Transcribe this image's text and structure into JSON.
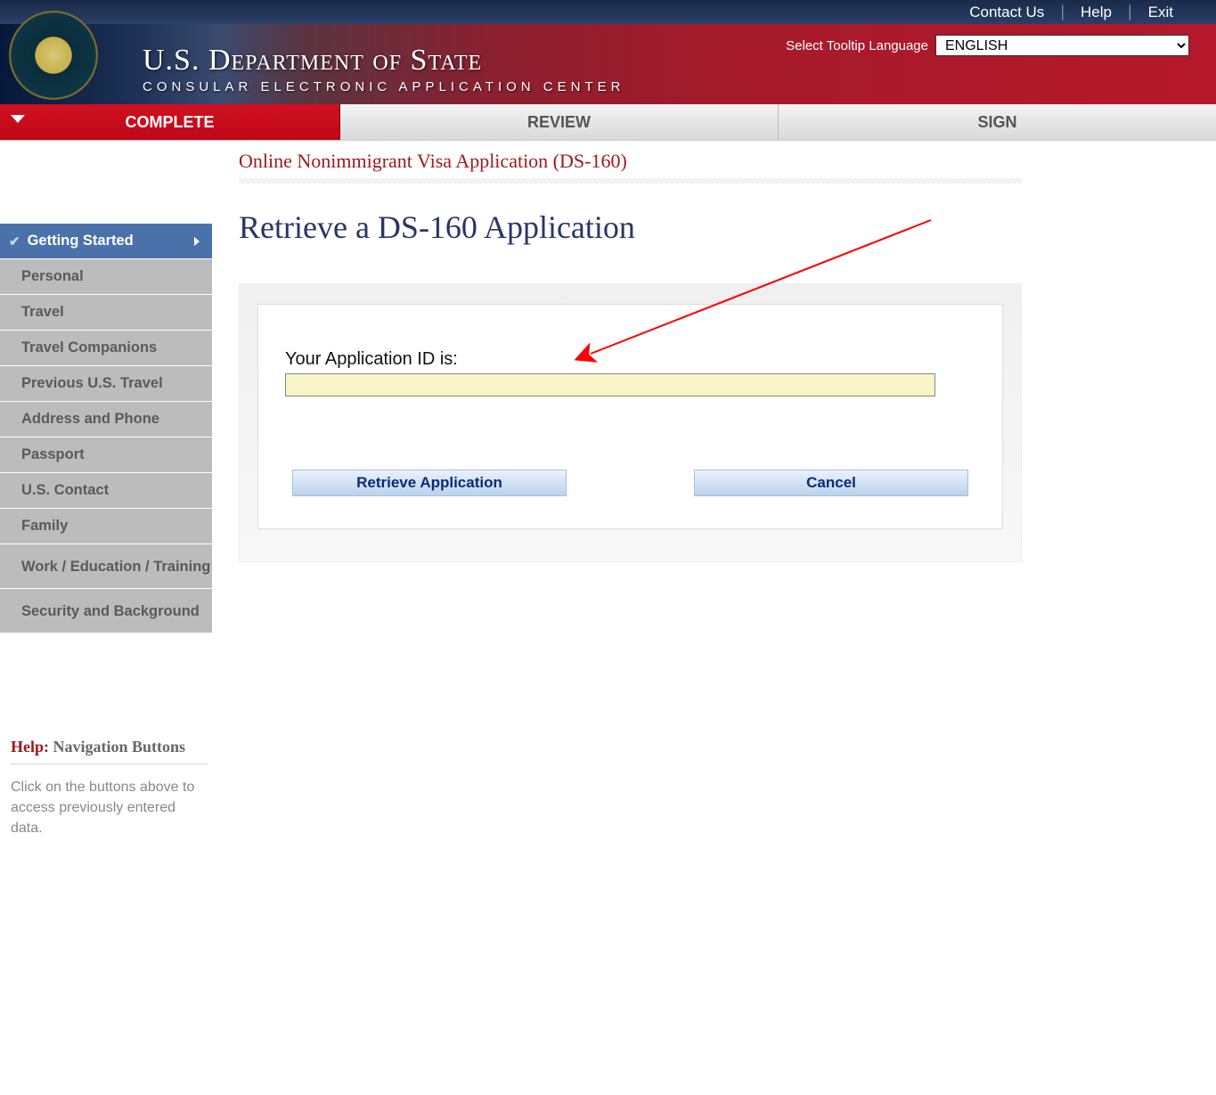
{
  "topbar": {
    "contact": "Contact Us",
    "help": "Help",
    "exit": "Exit"
  },
  "header": {
    "main_title": "U.S. Department of State",
    "sub_title": "CONSULAR ELECTRONIC APPLICATION CENTER",
    "lang_label": "Select Tooltip Language",
    "lang_value": "ENGLISH"
  },
  "tabs": {
    "complete": "COMPLETE",
    "review": "REVIEW",
    "sign": "SIGN"
  },
  "sidebar": {
    "items": [
      {
        "label": "Getting Started",
        "active": true
      },
      {
        "label": "Personal"
      },
      {
        "label": "Travel"
      },
      {
        "label": "Travel Companions"
      },
      {
        "label": "Previous U.S. Travel"
      },
      {
        "label": "Address and Phone"
      },
      {
        "label": "Passport"
      },
      {
        "label": "U.S. Contact"
      },
      {
        "label": "Family"
      },
      {
        "label": "Work / Education / Training",
        "multiline": true
      },
      {
        "label": "Security and Background",
        "multiline": true
      }
    ]
  },
  "helpbox": {
    "label": "Help:",
    "subject": " Navigation Buttons",
    "body": "Click on the buttons above to access previously entered data."
  },
  "main": {
    "breadcrumb": "Online Nonimmigrant Visa Application (DS-160)",
    "title": "Retrieve a DS-160 Application",
    "field_label": "Your Application ID is:",
    "field_value": "",
    "retrieve_btn": "Retrieve Application",
    "cancel_btn": "Cancel"
  }
}
